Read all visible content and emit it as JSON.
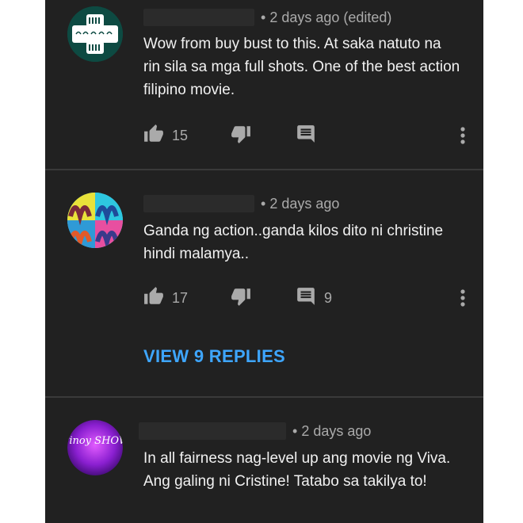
{
  "comments": [
    {
      "meta_time": "2 days ago (edited)",
      "text": "Wow from buy bust to this. At saka natuto na rin sila sa mga full shots. One of the best action filipino movie.",
      "likes": "15",
      "replies_count": ""
    },
    {
      "meta_time": "2 days ago",
      "text": "Ganda ng action..ganda kilos dito ni christine hindi malamya..",
      "likes": "17",
      "replies_count": "9",
      "view_replies": "VIEW 9 REPLIES"
    },
    {
      "meta_time": "2 days ago",
      "text": "In all fairness nag-level up ang movie ng Viva. Ang galing ni Cristine! Tatabo sa takilya to!"
    }
  ],
  "avatar3_text": "Pinoy SHOW",
  "icons": [
    "like-icon",
    "dislike-icon",
    "reply-icon",
    "more-options-icon"
  ],
  "colors": {
    "panel_bg": "#212121",
    "link_blue": "#3ea6ff",
    "text_primary": "#f1f1f1",
    "text_secondary": "#aaaaaa"
  }
}
